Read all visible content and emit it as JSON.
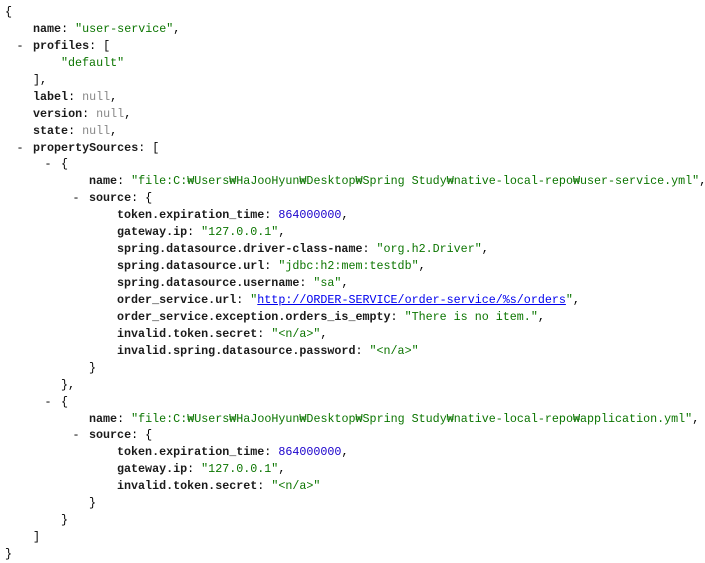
{
  "document": {
    "name": "user-service",
    "profiles": [
      "default"
    ],
    "label": null,
    "version": null,
    "state": null,
    "propertySources": [
      {
        "name": "file:C:₩Users₩HaJooHyun₩Desktop₩Spring Study₩native-local-repo₩user-service.yml",
        "source": {
          "token.expiration_time": 864000000,
          "gateway.ip": "127.0.0.1",
          "spring.datasource.driver-class-name": "org.h2.Driver",
          "spring.datasource.url": "jdbc:h2:mem:testdb",
          "spring.datasource.username": "sa",
          "order_service.url": "http://ORDER-SERVICE/order-service/%s/orders",
          "order_service.exception.orders_is_empty": "There is no item.",
          "invalid.token.secret": "<n/a>",
          "invalid.spring.datasource.password": "<n/a>"
        }
      },
      {
        "name": "file:C:₩Users₩HaJooHyun₩Desktop₩Spring Study₩native-local-repo₩application.yml",
        "source": {
          "token.expiration_time": 864000000,
          "gateway.ip": "127.0.0.1",
          "invalid.token.secret": "<n/a>"
        }
      }
    ]
  },
  "colors": {
    "key": "#1a1a1a",
    "string": "#0b7500",
    "number": "#1a01cc",
    "null": "#888888",
    "link": "#0000ee"
  },
  "icons": {
    "collapse": "minus-icon"
  }
}
